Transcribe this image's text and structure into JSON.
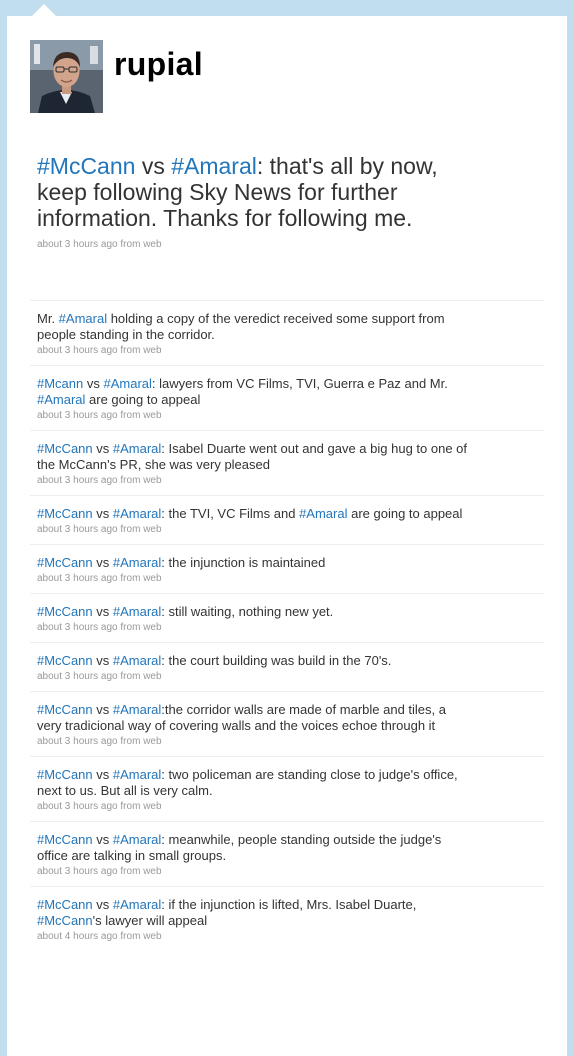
{
  "profile": {
    "screen_name": "rupial"
  },
  "featured": {
    "segments": [
      {
        "text": "#McCann",
        "tag": true
      },
      {
        "text": " vs ",
        "tag": false
      },
      {
        "text": "#Amaral",
        "tag": true
      },
      {
        "text": ": that's all by now, keep following Sky News for further information. Thanks for following me.",
        "tag": false
      }
    ],
    "time": "about 3 hours ago",
    "from": "from",
    "source": "web"
  },
  "tweets": [
    {
      "segments": [
        {
          "text": "Mr. ",
          "tag": false
        },
        {
          "text": "#Amaral",
          "tag": true
        },
        {
          "text": " holding a copy of the veredict received some support from people standing in the corridor.",
          "tag": false
        }
      ],
      "time": "about 3 hours ago",
      "from": "from",
      "source": "web"
    },
    {
      "segments": [
        {
          "text": "#Mcann",
          "tag": true
        },
        {
          "text": " vs ",
          "tag": false
        },
        {
          "text": "#Amaral",
          "tag": true
        },
        {
          "text": ": lawyers from VC Films, TVI, Guerra e Paz and Mr. ",
          "tag": false
        },
        {
          "text": "#Amaral",
          "tag": true
        },
        {
          "text": " are going to appeal",
          "tag": false
        }
      ],
      "time": "about 3 hours ago",
      "from": "from",
      "source": "web"
    },
    {
      "segments": [
        {
          "text": "#McCann",
          "tag": true
        },
        {
          "text": " vs ",
          "tag": false
        },
        {
          "text": "#Amaral",
          "tag": true
        },
        {
          "text": ": Isabel Duarte went out and gave a big hug to one of the McCann's PR, she was very pleased",
          "tag": false
        }
      ],
      "time": "about 3 hours ago",
      "from": "from",
      "source": "web"
    },
    {
      "segments": [
        {
          "text": "#McCann",
          "tag": true
        },
        {
          "text": " vs ",
          "tag": false
        },
        {
          "text": "#Amaral",
          "tag": true
        },
        {
          "text": ": the TVI, VC Films and ",
          "tag": false
        },
        {
          "text": "#Amaral",
          "tag": true
        },
        {
          "text": " are going to appeal",
          "tag": false
        }
      ],
      "time": "about 3 hours ago",
      "from": "from",
      "source": "web"
    },
    {
      "segments": [
        {
          "text": "#McCann",
          "tag": true
        },
        {
          "text": " vs ",
          "tag": false
        },
        {
          "text": "#Amaral",
          "tag": true
        },
        {
          "text": ": the injunction is maintained",
          "tag": false
        }
      ],
      "time": "about 3 hours ago",
      "from": "from",
      "source": "web"
    },
    {
      "segments": [
        {
          "text": "#McCann",
          "tag": true
        },
        {
          "text": " vs ",
          "tag": false
        },
        {
          "text": "#Amaral",
          "tag": true
        },
        {
          "text": ": still waiting, nothing new yet.",
          "tag": false
        }
      ],
      "time": "about 3 hours ago",
      "from": "from",
      "source": "web"
    },
    {
      "segments": [
        {
          "text": "#McCann",
          "tag": true
        },
        {
          "text": " vs ",
          "tag": false
        },
        {
          "text": "#Amaral",
          "tag": true
        },
        {
          "text": ": the court building was build in the 70's.",
          "tag": false
        }
      ],
      "time": "about 3 hours ago",
      "from": "from",
      "source": "web"
    },
    {
      "segments": [
        {
          "text": "#McCann",
          "tag": true
        },
        {
          "text": " vs ",
          "tag": false
        },
        {
          "text": "#Amaral",
          "tag": true
        },
        {
          "text": ":the corridor walls are made of marble and tiles, a very tradicional way of covering walls and the voices echoe through it",
          "tag": false
        }
      ],
      "time": "about 3 hours ago",
      "from": "from",
      "source": "web"
    },
    {
      "segments": [
        {
          "text": "#McCann",
          "tag": true
        },
        {
          "text": " vs ",
          "tag": false
        },
        {
          "text": "#Amaral",
          "tag": true
        },
        {
          "text": ": two policeman are standing close to judge's office, next to us. But all is very calm.",
          "tag": false
        }
      ],
      "time": "about 3 hours ago",
      "from": "from",
      "source": "web"
    },
    {
      "segments": [
        {
          "text": "#McCann",
          "tag": true
        },
        {
          "text": " vs ",
          "tag": false
        },
        {
          "text": "#Amaral",
          "tag": true
        },
        {
          "text": ": meanwhile, people standing outside the judge's office are talking in small groups.",
          "tag": false
        }
      ],
      "time": "about 3 hours ago",
      "from": "from",
      "source": "web"
    },
    {
      "segments": [
        {
          "text": "#McCann",
          "tag": true
        },
        {
          "text": " vs ",
          "tag": false
        },
        {
          "text": "#Amaral",
          "tag": true
        },
        {
          "text": ": if the injunction is lifted, Mrs. Isabel Duarte, ",
          "tag": false
        },
        {
          "text": "#McCann",
          "tag": true
        },
        {
          "text": "'s lawyer will appeal",
          "tag": false
        }
      ],
      "time": "about 4 hours ago",
      "from": "from",
      "source": "web"
    }
  ]
}
